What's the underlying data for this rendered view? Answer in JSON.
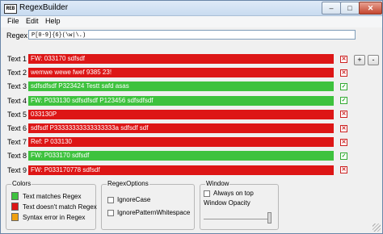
{
  "window": {
    "title": "RegexBuilder",
    "app_icon_text": "REB",
    "controls": {
      "minimize": "–",
      "maximize": "□",
      "close": "✕"
    }
  },
  "menu": {
    "items": [
      {
        "label": "File",
        "key": "F"
      },
      {
        "label": "Edit",
        "key": "E"
      },
      {
        "label": "Help",
        "key": "H"
      }
    ]
  },
  "regex": {
    "label": "Regex",
    "value": "P[0-9]{6}(\\w|\\.)"
  },
  "buttons": {
    "add": "+",
    "remove": "-"
  },
  "rows": [
    {
      "label": "Text 1",
      "value": "FW: 033170 sdfsdf",
      "match": false
    },
    {
      "label": "Text 2",
      "value": "wemwe wewe fwef 9385 23!",
      "match": false
    },
    {
      "label": "Text 3",
      "value": "sdfsdfsdf P323424 Testt safd asas",
      "match": true
    },
    {
      "label": "Text 4",
      "value": "FW: P033130 sdfsdfsdf P123456 sdfsdfsdf",
      "match": true
    },
    {
      "label": "Text 5",
      "value": "033130P",
      "match": false
    },
    {
      "label": "Text 6",
      "value": "sdfsdf P33333333333333333a sdfsdf sdf",
      "match": false
    },
    {
      "label": "Text 7",
      "value": "Ref: P 033130",
      "match": false
    },
    {
      "label": "Text 8",
      "value": "FW: P033170 sdfsdf",
      "match": true
    },
    {
      "label": "Text 9",
      "value": "FW: P033170778 sdfsdf",
      "match": false
    }
  ],
  "colors_group": {
    "title": "Colors",
    "items": [
      {
        "label": "Text matches Regex",
        "color": "#3ec23e"
      },
      {
        "label": "Text doesn't match Regex",
        "color": "#dd1616"
      },
      {
        "label": "Syntax error in Regex",
        "color": "#f0a010"
      }
    ]
  },
  "regex_options": {
    "title": "RegexOptions",
    "ignore_case": "IgnoreCase",
    "ignore_pattern_whitespace": "IgnorePatternWhitespace"
  },
  "window_group": {
    "title": "Window",
    "always_on_top": "Always on top",
    "opacity_label": "Window Opacity",
    "opacity": 1.0
  }
}
